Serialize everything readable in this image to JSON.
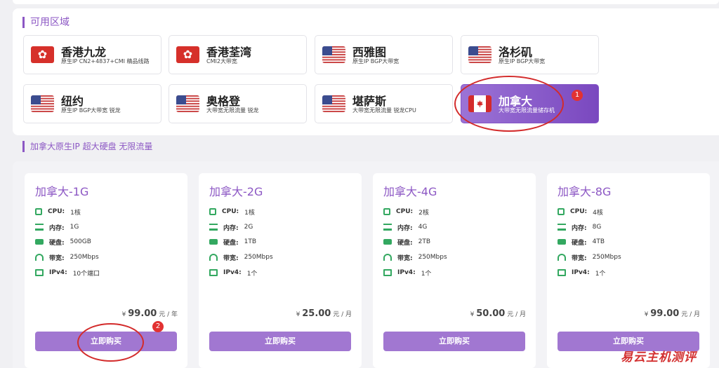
{
  "regions": {
    "title": "可用区域",
    "items": [
      {
        "name": "香港九龙",
        "desc": "原生IP CN2+4837+CMI 精品线路",
        "flag": "hk"
      },
      {
        "name": "香港荃湾",
        "desc": "CMI2大带宽",
        "flag": "hk"
      },
      {
        "name": "西雅图",
        "desc": "原生IP BGP大带宽",
        "flag": "us"
      },
      {
        "name": "洛杉矶",
        "desc": "原生IP BGP大带宽",
        "flag": "us"
      },
      {
        "name": "纽约",
        "desc": "原生IP BGP大带宽 锐龙",
        "flag": "us"
      },
      {
        "name": "奥格登",
        "desc": "大带宽无限流量 锐龙",
        "flag": "us"
      },
      {
        "name": "堪萨斯",
        "desc": "大带宽无限流量 锐龙CPU",
        "flag": "us"
      },
      {
        "name": "加拿大",
        "desc": "大带宽无限流量储存机",
        "flag": "ca",
        "selected": true
      }
    ]
  },
  "annotations": {
    "badge_1": "1",
    "badge_2": "2"
  },
  "plans_section": {
    "title": "加拿大原生IP 超大硬盘 无限流量",
    "labels": {
      "cpu": "CPU:",
      "ram": "内存:",
      "disk": "硬盘:",
      "bw": "带宽:",
      "ip": "IPv4:"
    },
    "buy_label": "立即购买",
    "currency": "¥",
    "plans": [
      {
        "name": "加拿大-1G",
        "cpu": "1核",
        "ram": "1G",
        "disk": "500GB",
        "bw": "250Mbps",
        "ip": "10个端口",
        "price": "99.00",
        "unit": "元 / 年"
      },
      {
        "name": "加拿大-2G",
        "cpu": "1核",
        "ram": "2G",
        "disk": "1TB",
        "bw": "250Mbps",
        "ip": "1个",
        "price": "25.00",
        "unit": "元 / 月"
      },
      {
        "name": "加拿大-4G",
        "cpu": "2核",
        "ram": "4G",
        "disk": "2TB",
        "bw": "250Mbps",
        "ip": "1个",
        "price": "50.00",
        "unit": "元 / 月"
      },
      {
        "name": "加拿大-8G",
        "cpu": "4核",
        "ram": "8G",
        "disk": "4TB",
        "bw": "250Mbps",
        "ip": "1个",
        "price": "99.00",
        "unit": "元 / 月"
      }
    ]
  },
  "watermark": "易云主机测评",
  "colors": {
    "accent": "#8c57c4",
    "button": "#a177d1",
    "icon_green": "#33a860",
    "annotation_red": "#d32b2b"
  }
}
